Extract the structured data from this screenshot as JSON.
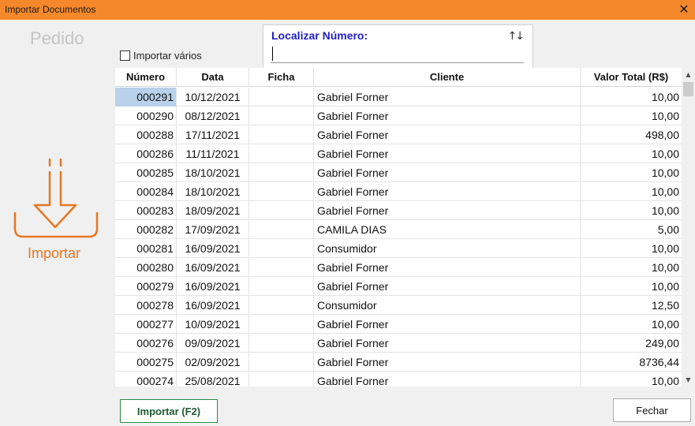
{
  "window": {
    "title": "Importar Documentos",
    "close_glyph": "✕",
    "accent_color": "#f5882a"
  },
  "sidebar": {
    "heading": "Pedido",
    "import_icon": "download-tray-icon",
    "import_label": "Importar"
  },
  "options": {
    "import_multiple_label": "Importar vários",
    "import_multiple_checked": false
  },
  "search": {
    "label": "Localizar Número:",
    "value": "",
    "sort_icon": "↑↓"
  },
  "grid": {
    "columns": [
      "Número",
      "Data",
      "Ficha",
      "Cliente",
      "Valor Total (R$)"
    ],
    "selected_index": 0,
    "rows": [
      {
        "numero": "000291",
        "data": "10/12/2021",
        "ficha": "",
        "cliente": "Gabriel Forner",
        "valor": "10,00"
      },
      {
        "numero": "000290",
        "data": "08/12/2021",
        "ficha": "",
        "cliente": "Gabriel Forner",
        "valor": "10,00"
      },
      {
        "numero": "000288",
        "data": "17/11/2021",
        "ficha": "",
        "cliente": "Gabriel Forner",
        "valor": "498,00"
      },
      {
        "numero": "000286",
        "data": "11/11/2021",
        "ficha": "",
        "cliente": "Gabriel Forner",
        "valor": "10,00"
      },
      {
        "numero": "000285",
        "data": "18/10/2021",
        "ficha": "",
        "cliente": "Gabriel Forner",
        "valor": "10,00"
      },
      {
        "numero": "000284",
        "data": "18/10/2021",
        "ficha": "",
        "cliente": "Gabriel Forner",
        "valor": "10,00"
      },
      {
        "numero": "000283",
        "data": "18/09/2021",
        "ficha": "",
        "cliente": "Gabriel Forner",
        "valor": "10,00"
      },
      {
        "numero": "000282",
        "data": "17/09/2021",
        "ficha": "",
        "cliente": "CAMILA DIAS",
        "valor": "5,00"
      },
      {
        "numero": "000281",
        "data": "16/09/2021",
        "ficha": "",
        "cliente": "Consumidor",
        "valor": "10,00"
      },
      {
        "numero": "000280",
        "data": "16/09/2021",
        "ficha": "",
        "cliente": "Gabriel Forner",
        "valor": "10,00"
      },
      {
        "numero": "000279",
        "data": "16/09/2021",
        "ficha": "",
        "cliente": "Gabriel Forner",
        "valor": "10,00"
      },
      {
        "numero": "000278",
        "data": "16/09/2021",
        "ficha": "",
        "cliente": "Consumidor",
        "valor": "12,50"
      },
      {
        "numero": "000277",
        "data": "10/09/2021",
        "ficha": "",
        "cliente": "Gabriel Forner",
        "valor": "10,00"
      },
      {
        "numero": "000276",
        "data": "09/09/2021",
        "ficha": "",
        "cliente": "Gabriel Forner",
        "valor": "249,00"
      },
      {
        "numero": "000275",
        "data": "02/09/2021",
        "ficha": "",
        "cliente": "Gabriel Forner",
        "valor": "8736,44"
      },
      {
        "numero": "000274",
        "data": "25/08/2021",
        "ficha": "",
        "cliente": "Gabriel Forner",
        "valor": "10,00"
      }
    ]
  },
  "scrollbar": {
    "up_glyph": "▲",
    "down_glyph": "▼"
  },
  "buttons": {
    "import_label": "Importar (F2)",
    "close_label": "Fechar"
  }
}
